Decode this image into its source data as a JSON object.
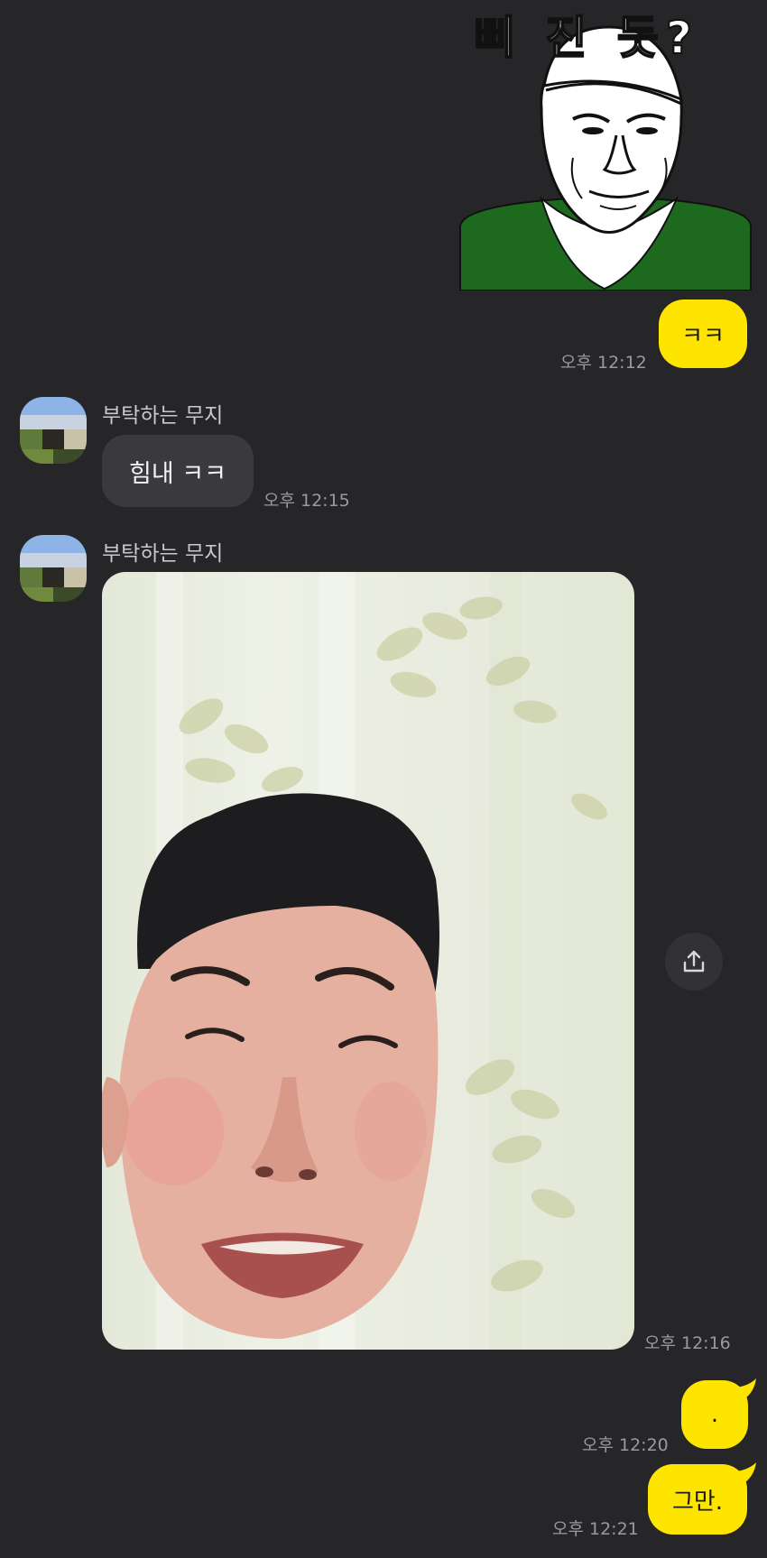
{
  "sticker": {
    "caption": "삐 진 듯?"
  },
  "messages": [
    {
      "id": "m1",
      "from": "me",
      "text": "ㅋㅋ",
      "time": "오후 12:12"
    },
    {
      "id": "m2",
      "from": "other",
      "sender": "부탁하는 무지",
      "text": "힘내 ㅋㅋ",
      "time": "오후 12:15"
    },
    {
      "id": "m3",
      "from": "other",
      "sender": "부탁하는 무지",
      "type": "photo",
      "time": "오후 12:16"
    },
    {
      "id": "m4",
      "from": "me",
      "text": ".",
      "time": "오후 12:20"
    },
    {
      "id": "m5",
      "from": "me",
      "text": "그만.",
      "time": "오후 12:21"
    }
  ],
  "colors": {
    "background": "#262629",
    "my_bubble": "#fee500",
    "other_bubble": "#3a3a3e"
  },
  "icons": {
    "share": "share-icon"
  }
}
